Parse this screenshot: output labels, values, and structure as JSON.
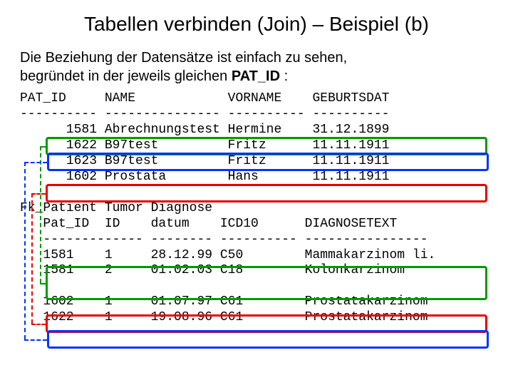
{
  "title": "Tabellen verbinden (Join) – Beispiel (b)",
  "intro_line1": "Die Beziehung der Datensätze ist einfach zu sehen,",
  "intro_line2_a": "begründet in der jeweils gleichen ",
  "intro_line2_b": "PAT_ID",
  "intro_line2_c": " :",
  "table1": {
    "headers": {
      "c1": "PAT_ID",
      "c2": "NAME",
      "c3": "VORNAME",
      "c4": "GEBURTSDAT"
    },
    "sep": {
      "c1": "----------",
      "c2": "---------------",
      "c3": "----------",
      "c4": "----------"
    },
    "rows": [
      {
        "c1": "1581",
        "c2": "Abrechnungstest",
        "c3": "Hermine",
        "c4": "31.12.1899"
      },
      {
        "c1": "1622",
        "c2": "B97test",
        "c3": "Fritz",
        "c4": "11.11.1911"
      },
      {
        "c1": "1623",
        "c2": "B97test",
        "c3": "Fritz",
        "c4": "11.11.1911"
      },
      {
        "c1": "1602",
        "c2": "Prostata",
        "c3": "Hans",
        "c4": "11.11.1911"
      }
    ]
  },
  "table2": {
    "headers1": {
      "c1": "Fk_Patient",
      "c2": "Tumor",
      "c3": "Diagnose",
      "c4": "",
      "c5": ""
    },
    "headers2": {
      "c1": "Pat_ID",
      "c2": "ID",
      "c3": "datum",
      "c4": "ICD10",
      "c5": "DIAGNOSETEXT"
    },
    "sep": {
      "c1": "--------",
      "c2": "-----",
      "c3": "--------",
      "c4": "----------",
      "c5": "----------------"
    },
    "rowsA": [
      {
        "c1": "1581",
        "c2": "1",
        "c3": "28.12.99",
        "c4": "C50",
        "c5": "Mammakarzinom li."
      },
      {
        "c1": "1581",
        "c2": "2",
        "c3": "01.02.03",
        "c4": "C18",
        "c5": "Kolonkarzinom"
      }
    ],
    "rowsB": [
      {
        "c1": "1602",
        "c2": "1",
        "c3": "01.07.97",
        "c4": "C61",
        "c5": "Prostatakarzinom"
      },
      {
        "c1": "1622",
        "c2": "1",
        "c3": "19.08.96",
        "c4": "C61",
        "c5": "Prostatakarzinom"
      }
    ]
  }
}
